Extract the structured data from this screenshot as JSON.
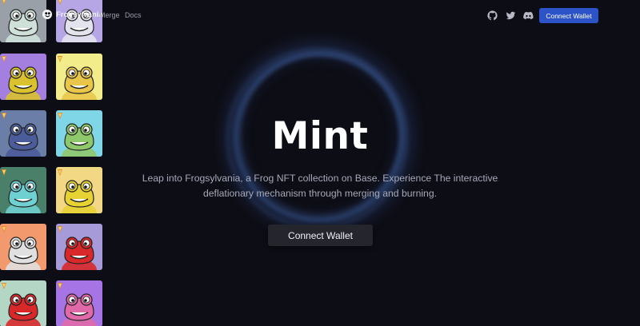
{
  "nav": {
    "brand_name": "Frogsylvania",
    "links": [
      {
        "label": "Merge"
      },
      {
        "label": "Docs"
      }
    ],
    "social_icons": [
      "github-icon",
      "twitter-icon",
      "discord-icon"
    ],
    "connect_label": "Connect Wallet",
    "connect_color": "#2c54c8"
  },
  "hero": {
    "title": "Mint",
    "description": "Leap into Frogsylvania, a Frog NFT collection on Base. Experience The interactive deflationary mechanism through merging and burning.",
    "button_label": "Connect Wallet"
  },
  "theme": {
    "background": "#0d0d15",
    "ring_color": "#3b5b9a"
  },
  "nft_strip": {
    "cards": [
      {
        "bg": "#9aa0a8",
        "frog": "#cfe0d8",
        "icon": "frog-nft-icon"
      },
      {
        "bg": "#b7a6e6",
        "frog": "#e3e3ee",
        "icon": "frog-nft-icon"
      },
      {
        "bg": "#a57fe0",
        "frog": "#d9c22e",
        "icon": "frog-nft-icon"
      },
      {
        "bg": "#f2ec8a",
        "frog": "#e9c64a",
        "icon": "frog-nft-icon"
      },
      {
        "bg": "#6a7ea8",
        "frog": "#4b5c9a",
        "icon": "frog-nft-icon"
      },
      {
        "bg": "#7fd6e6",
        "frog": "#8fc86a",
        "icon": "frog-nft-icon"
      },
      {
        "bg": "#4a7f6a",
        "frog": "#6fd0d2",
        "icon": "frog-nft-icon"
      },
      {
        "bg": "#f2d784",
        "frog": "#e7d234",
        "icon": "frog-nft-icon"
      },
      {
        "bg": "#f29a6e",
        "frog": "#e0e0e0",
        "icon": "frog-nft-icon"
      },
      {
        "bg": "#a69ad8",
        "frog": "#d8282a",
        "icon": "frog-nft-icon"
      },
      {
        "bg": "#b4d6c4",
        "frog": "#d8282a",
        "icon": "frog-nft-icon"
      },
      {
        "bg": "#a774e6",
        "frog": "#e06aa8",
        "icon": "frog-nft-icon"
      }
    ],
    "badge_icon": "flame-badge-icon",
    "badge_color": "#e08a2a"
  }
}
